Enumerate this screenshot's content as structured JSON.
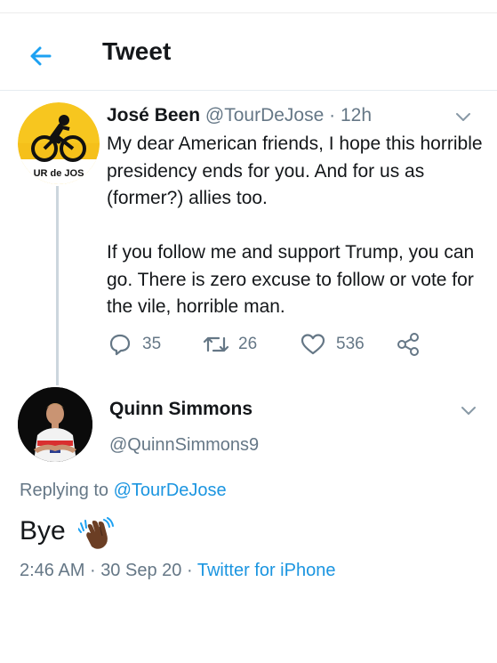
{
  "header": {
    "title": "Tweet",
    "back_icon": "back-arrow-icon",
    "accent": "#1da1f2"
  },
  "tweet": {
    "name": "José Been",
    "handle": "@TourDeJose",
    "separator": "·",
    "time": "12h",
    "avatar_text": "UR de JOS",
    "paragraph1": "My dear American friends, I hope this horrible presidency ends for you. And for us as (former?) allies too.",
    "paragraph2": "If you follow me and support Trump, you can go. There is zero excuse to follow or vote for the vile, horrible man.",
    "replies": "35",
    "retweets": "26",
    "likes": "536"
  },
  "reply": {
    "name": "Quinn Simmons",
    "handle": "@QuinnSimmons9",
    "replying_prefix": "Replying to",
    "replying_handle": "@TourDeJose",
    "text": "Bye",
    "emoji": "waving-hand-icon",
    "time": "2:46 AM",
    "date": "30 Sep 20",
    "source": "Twitter for iPhone"
  }
}
